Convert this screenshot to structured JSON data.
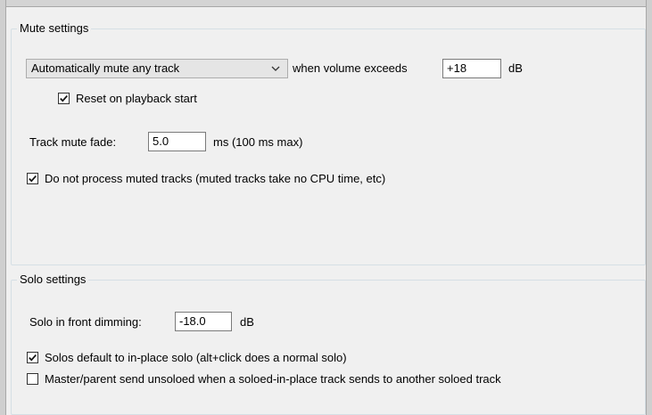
{
  "mute": {
    "legend": "Mute settings",
    "auto_mute_select": "Automatically mute any track",
    "when_volume_label": "when volume exceeds",
    "volume_value": "+18",
    "db_unit": "dB",
    "reset_label": "Reset on playback start",
    "reset_checked": true,
    "fade_label": "Track mute fade:",
    "fade_value": "5.0",
    "fade_unit": "ms (100 ms max)",
    "no_process_label": "Do not process muted tracks (muted tracks take no CPU time, etc)",
    "no_process_checked": true
  },
  "solo": {
    "legend": "Solo settings",
    "dimming_label": "Solo in front dimming:",
    "dimming_value": "-18.0",
    "dimming_unit": "dB",
    "inplace_label": "Solos default to in-place solo (alt+click does a normal solo)",
    "inplace_checked": true,
    "master_label": "Master/parent send unsoloed when a soloed-in-place track sends to another soloed track",
    "master_checked": false
  },
  "icons": {
    "check": "check-icon",
    "dropdown": "chevron-down-icon"
  }
}
